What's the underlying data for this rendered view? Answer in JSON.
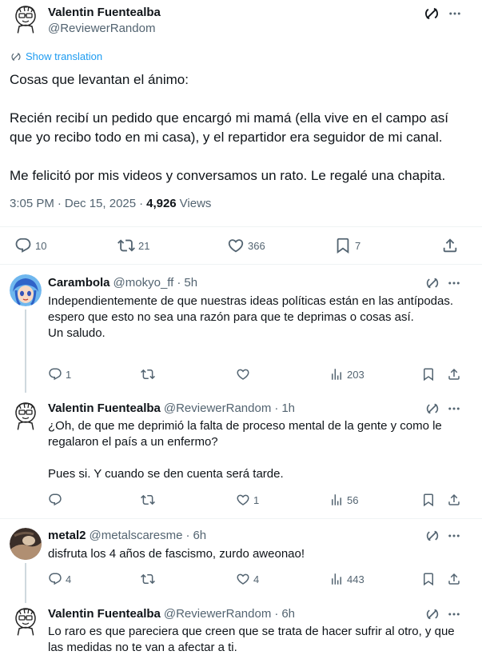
{
  "main_post": {
    "author_name": "Valentin Fuentealba",
    "author_handle": "@ReviewerRandom",
    "show_translation": "Show translation",
    "text": "Cosas que levantan el ánimo:\n\nRecién recibí un pedido que encargó mi mamá (ella vive en el campo así que yo recibo todo en mi casa), y el repartidor era seguidor de mi canal.\n\nMe felicitó por mis videos y conversamos un rato. Le regalé una chapita.",
    "time": "3:05 PM",
    "date": "Dec 15, 2025",
    "views_count": "4,926",
    "views_label": "Views",
    "replies": "10",
    "reposts": "21",
    "likes": "366",
    "bookmarks": "7"
  },
  "replies": [
    {
      "author_name": "Carambola",
      "author_handle": "@mokyo_ff",
      "time": "5h",
      "text": "Independientemente de que nuestras ideas políticas están en las antípodas.\nespero que esto no sea una razón para que te deprimas o cosas así.\nUn saludo.",
      "replies": "1",
      "reposts": "",
      "likes": "",
      "views": "203"
    },
    {
      "author_name": "Valentin Fuentealba",
      "author_handle": "@ReviewerRandom",
      "time": "1h",
      "text": "¿Oh, de que me deprimió la falta de proceso mental de la gente y como le regalaron el país a un enfermo?\n\nPues si. Y cuando se den cuenta será tarde.",
      "replies": "",
      "reposts": "",
      "likes": "1",
      "views": "56"
    },
    {
      "author_name": "metal2",
      "author_handle": "@metalscaresme",
      "time": "6h",
      "text": "disfruta los 4 años de fascismo, zurdo aweonao!",
      "replies": "4",
      "reposts": "",
      "likes": "4",
      "views": "443"
    },
    {
      "author_name": "Valentin Fuentealba",
      "author_handle": "@ReviewerRandom",
      "time": "6h",
      "text": "Lo raro es que pareciera que creen que se trata de hacer sufrir al otro, y que las medidas no te van a afectar a ti."
    }
  ],
  "separator_dot": "·",
  "colors": {
    "text": "#0f1419",
    "muted": "#536471",
    "link": "#1d9bf0",
    "divider": "#eff3f4"
  }
}
